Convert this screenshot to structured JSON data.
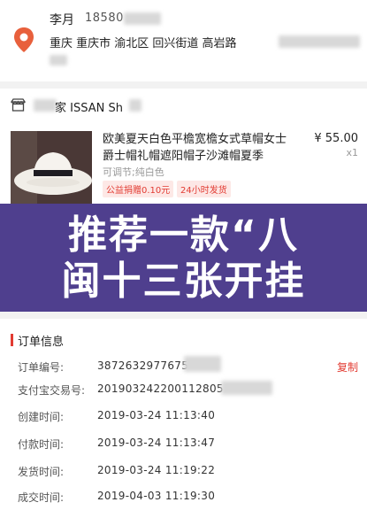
{
  "address": {
    "name": "李月",
    "phone": "18580",
    "line1": "重庆 重庆市 渝北区 回兴街道 高岩路",
    "line2": ""
  },
  "shop": {
    "name": "家 ISSAN Sh"
  },
  "product": {
    "title": "欧美夏天白色平檐宽檐女式草帽女士爵士帽礼帽遮阳帽子沙滩帽夏季",
    "price": "¥ 55.00",
    "quantity": "x1",
    "spec": "可调节;纯白色",
    "tag_charity": "公益捐赠0.10元",
    "tag_shipping": "24小时发货"
  },
  "banner": {
    "line1": "推荐一款“八",
    "line2": "闽十三张开挂"
  },
  "order": {
    "title": "订单信息",
    "copy_label": "复制",
    "rows": [
      {
        "label": "订单编号:",
        "value": "3872632977675"
      },
      {
        "label": "支付宝交易号:",
        "value": "201903242200112805"
      },
      {
        "label": "创建时间:",
        "value": "2019-03-24 11:13:40"
      },
      {
        "label": "付款时间:",
        "value": "2019-03-24 11:13:47"
      },
      {
        "label": "发货时间:",
        "value": "2019-03-24 11:19:22"
      },
      {
        "label": "成交时间:",
        "value": "2019-04-03 11:19:30"
      }
    ]
  },
  "colors": {
    "accent": "#e23b32",
    "banner": "#4f3f8e",
    "pin": "#e8603c"
  }
}
